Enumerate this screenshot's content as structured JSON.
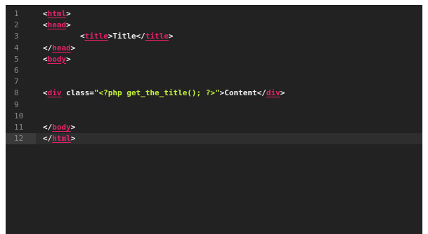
{
  "editor": {
    "lines": [
      {
        "n": "1",
        "tokens": [
          [
            "tag",
            "<"
          ],
          [
            "tn",
            "html"
          ],
          [
            "tag",
            ">"
          ]
        ]
      },
      {
        "n": "2",
        "tokens": [
          [
            "tag",
            "<"
          ],
          [
            "tn",
            "head"
          ],
          [
            "tag",
            ">"
          ]
        ]
      },
      {
        "n": "3",
        "tokens": [
          [
            "txt",
            "        "
          ],
          [
            "tag",
            "<"
          ],
          [
            "tn",
            "title"
          ],
          [
            "tag",
            ">"
          ],
          [
            "txt",
            "Title"
          ],
          [
            "tag",
            "</"
          ],
          [
            "tn",
            "title"
          ],
          [
            "tag",
            ">"
          ]
        ]
      },
      {
        "n": "4",
        "tokens": [
          [
            "tag",
            "</"
          ],
          [
            "tn",
            "head"
          ],
          [
            "tag",
            ">"
          ]
        ]
      },
      {
        "n": "5",
        "tokens": [
          [
            "tag",
            "<"
          ],
          [
            "tn",
            "body"
          ],
          [
            "tag",
            ">"
          ]
        ]
      },
      {
        "n": "6",
        "tokens": []
      },
      {
        "n": "7",
        "tokens": []
      },
      {
        "n": "8",
        "tokens": [
          [
            "tag",
            "<"
          ],
          [
            "tn",
            "div"
          ],
          [
            "attr",
            " class="
          ],
          [
            "str",
            "\"<?php get_the_title(); ?>\""
          ],
          [
            "tag",
            ">"
          ],
          [
            "txt",
            "Content"
          ],
          [
            "tag",
            "</"
          ],
          [
            "tn",
            "div"
          ],
          [
            "tag",
            ">"
          ]
        ]
      },
      {
        "n": "9",
        "tokens": []
      },
      {
        "n": "10",
        "tokens": []
      },
      {
        "n": "11",
        "tokens": [
          [
            "tag",
            "</"
          ],
          [
            "tn",
            "body"
          ],
          [
            "tag",
            ">"
          ]
        ]
      },
      {
        "n": "12",
        "tokens": [
          [
            "tag",
            "</"
          ],
          [
            "tn",
            "html"
          ],
          [
            "tag",
            ">"
          ]
        ],
        "active": true
      }
    ],
    "colors": {
      "background": "#222222",
      "tag_name": "#e8206a",
      "string": "#c5f23a",
      "text": "#f2f2f2",
      "line_number": "#8a8a8a"
    }
  }
}
